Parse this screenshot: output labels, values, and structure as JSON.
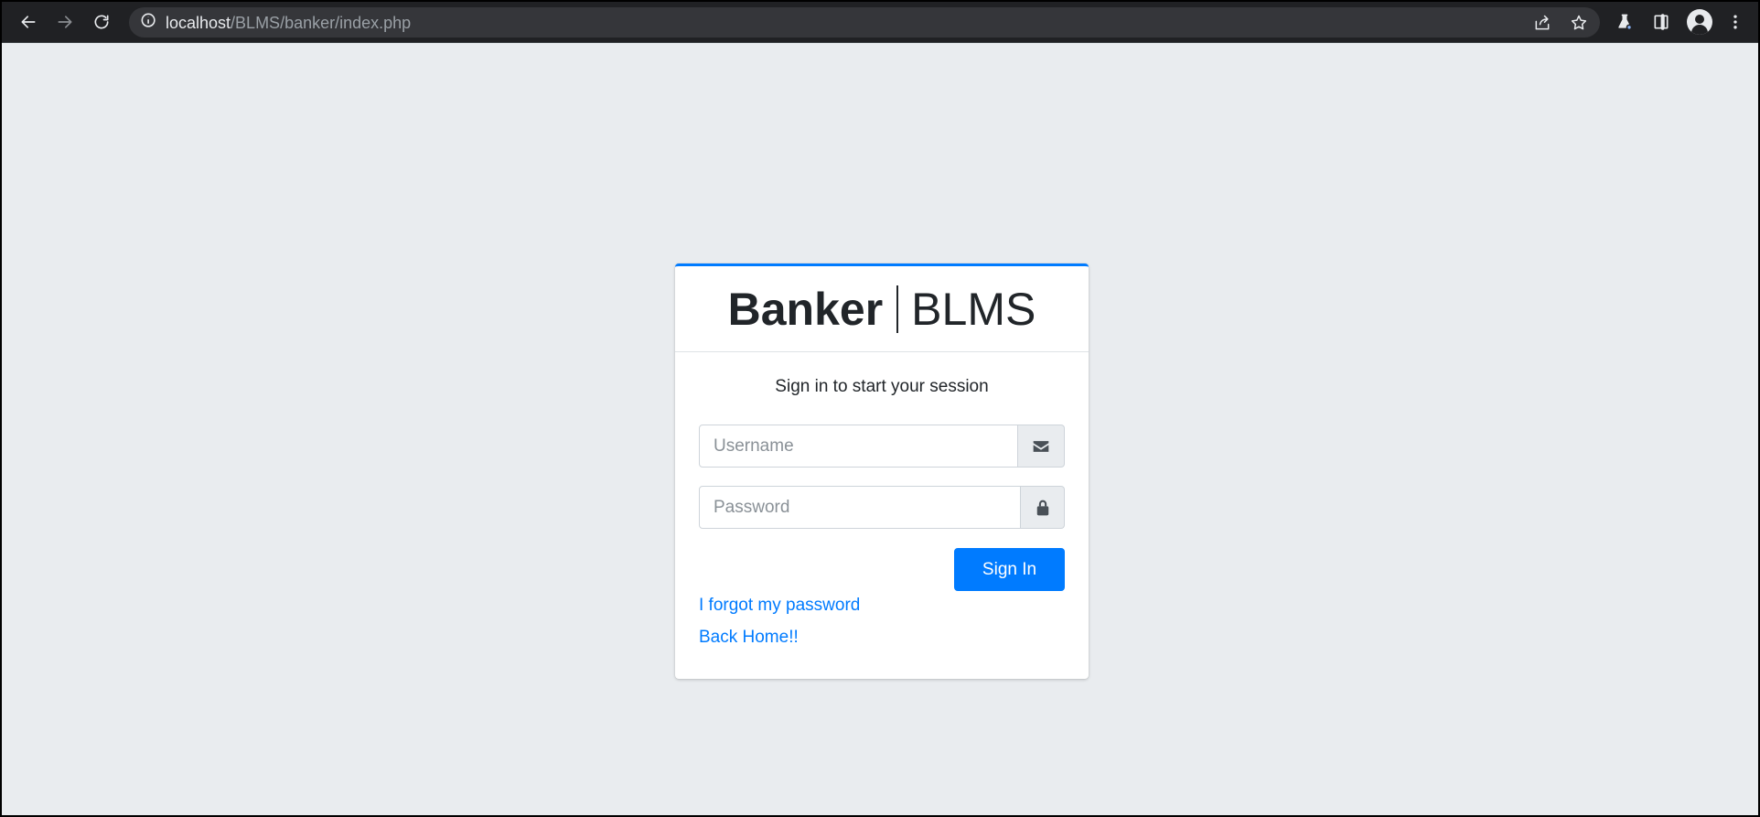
{
  "browser": {
    "url_host": "localhost",
    "url_path": "/BLMS/banker/index.php"
  },
  "login": {
    "brand_bold": "Banker",
    "brand_light": "BLMS",
    "message": "Sign in to start your session",
    "username_placeholder": "Username",
    "password_placeholder": "Password",
    "signin_label": "Sign In",
    "forgot_link": "I forgot my password",
    "home_link": "Back Home!!"
  },
  "colors": {
    "accent": "#007bff",
    "page_bg": "#e9ecef",
    "toolbar_bg": "#202124"
  }
}
